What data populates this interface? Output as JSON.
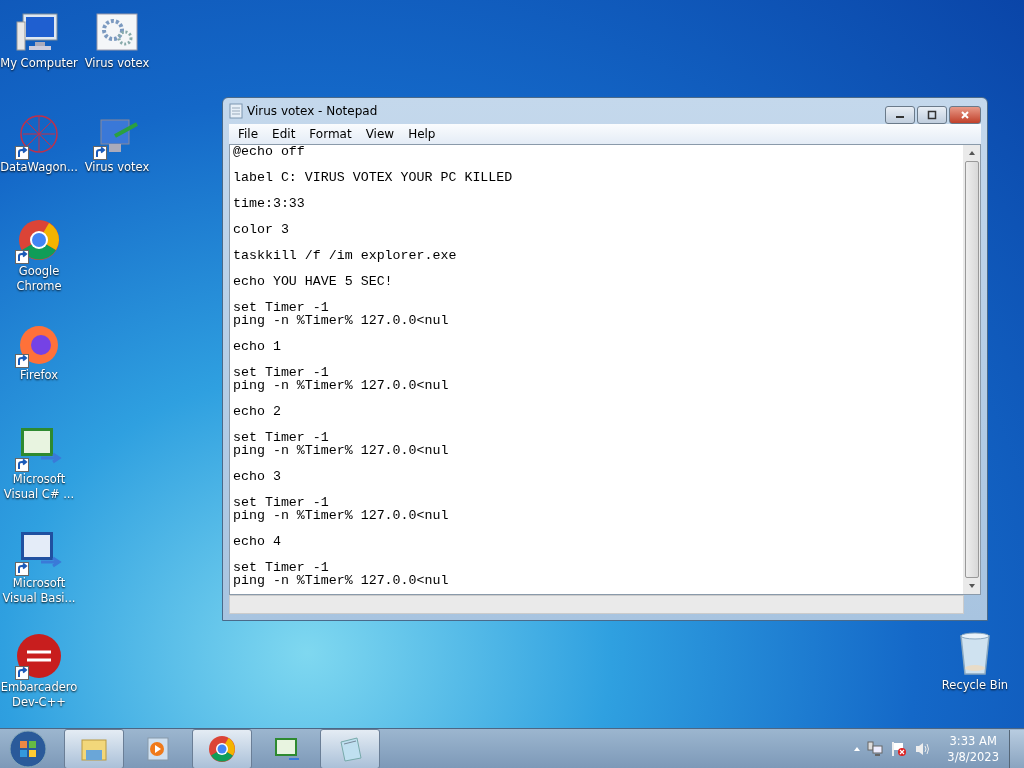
{
  "desktop": {
    "columns": [
      [
        {
          "label": "My Computer",
          "kind": "computer",
          "shortcut": false
        },
        {
          "label": "DataWagon...",
          "kind": "network",
          "shortcut": true
        },
        {
          "label": "Google Chrome",
          "kind": "chrome",
          "shortcut": true
        },
        {
          "label": "Firefox",
          "kind": "firefox",
          "shortcut": true
        },
        {
          "label": "Microsoft Visual C# ...",
          "kind": "csharp",
          "shortcut": true
        },
        {
          "label": "Microsoft Visual Basi...",
          "kind": "vb",
          "shortcut": true
        },
        {
          "label": "Embarcadero Dev-C++",
          "kind": "devcpp",
          "shortcut": true
        }
      ],
      [
        {
          "label": "Virus votex",
          "kind": "settings",
          "shortcut": false
        },
        {
          "label": "Virus votex",
          "kind": "paint",
          "shortcut": true
        }
      ]
    ],
    "recycle_bin": {
      "label": "Recycle Bin"
    }
  },
  "window": {
    "title": "Virus votex - Notepad",
    "menu": [
      "File",
      "Edit",
      "Format",
      "View",
      "Help"
    ],
    "text": [
      [
        "@echo off"
      ],
      [
        "label C: VIRUS VOTEX YOUR PC KILLED"
      ],
      [
        "time:3:33"
      ],
      [
        "color 3"
      ],
      [
        "taskkill /f /im explorer.exe"
      ],
      [
        "echo YOU HAVE 5 SEC!"
      ],
      [
        "set Timer -1",
        "ping -n %Timer% 127.0.0<nul"
      ],
      [
        "echo 1"
      ],
      [
        "set Timer -1",
        "ping -n %Timer% 127.0.0<nul"
      ],
      [
        "echo 2"
      ],
      [
        "set Timer -1",
        "ping -n %Timer% 127.0.0<nul"
      ],
      [
        "echo 3"
      ],
      [
        "set Timer -1",
        "ping -n %Timer% 127.0.0<nul"
      ],
      [
        "echo 4"
      ],
      [
        "set Timer -1",
        "ping -n %Timer% 127.0.0<nul"
      ]
    ]
  },
  "taskbar": {
    "items": [
      {
        "kind": "explorer",
        "open": true
      },
      {
        "kind": "media",
        "open": false
      },
      {
        "kind": "chrome",
        "open": true
      },
      {
        "kind": "csharp",
        "open": false
      },
      {
        "kind": "notepad",
        "open": true
      }
    ],
    "tray": {
      "time": "3:33 AM",
      "date": "3/8/2023"
    }
  }
}
